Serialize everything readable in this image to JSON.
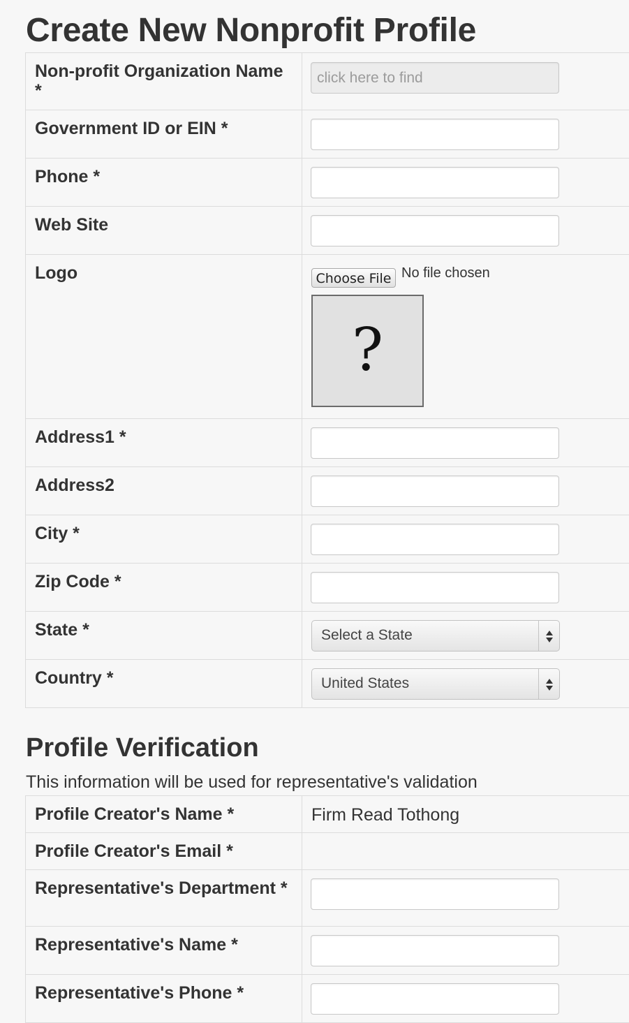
{
  "page_title": "Create New Nonprofit Profile",
  "org_fields": [
    {
      "label": "Non-profit Organization Name *",
      "placeholder": "click here to find"
    },
    {
      "label": "Government ID or EIN *"
    },
    {
      "label": "Phone *"
    },
    {
      "label": "Web Site"
    },
    {
      "label": "Logo",
      "choose_file": "Choose File",
      "no_file": "No file chosen",
      "logo_placeholder": "?"
    },
    {
      "label": "Address1 *"
    },
    {
      "label": "Address2"
    },
    {
      "label": "City *"
    },
    {
      "label": "Zip Code *"
    },
    {
      "label": "State *",
      "selected": "Select a State"
    },
    {
      "label": "Country *",
      "selected": "United States"
    }
  ],
  "verification": {
    "title": "Profile Verification",
    "subtitle": "This information will be used for representative's validation",
    "fields": [
      {
        "label": "Profile Creator's Name *",
        "value": "Firm Read Tothong"
      },
      {
        "label": "Profile Creator's Email *",
        "value": ""
      },
      {
        "label": "Representative's Department *"
      },
      {
        "label": "Representative's Name *"
      },
      {
        "label": "Representative's Phone *"
      }
    ]
  }
}
